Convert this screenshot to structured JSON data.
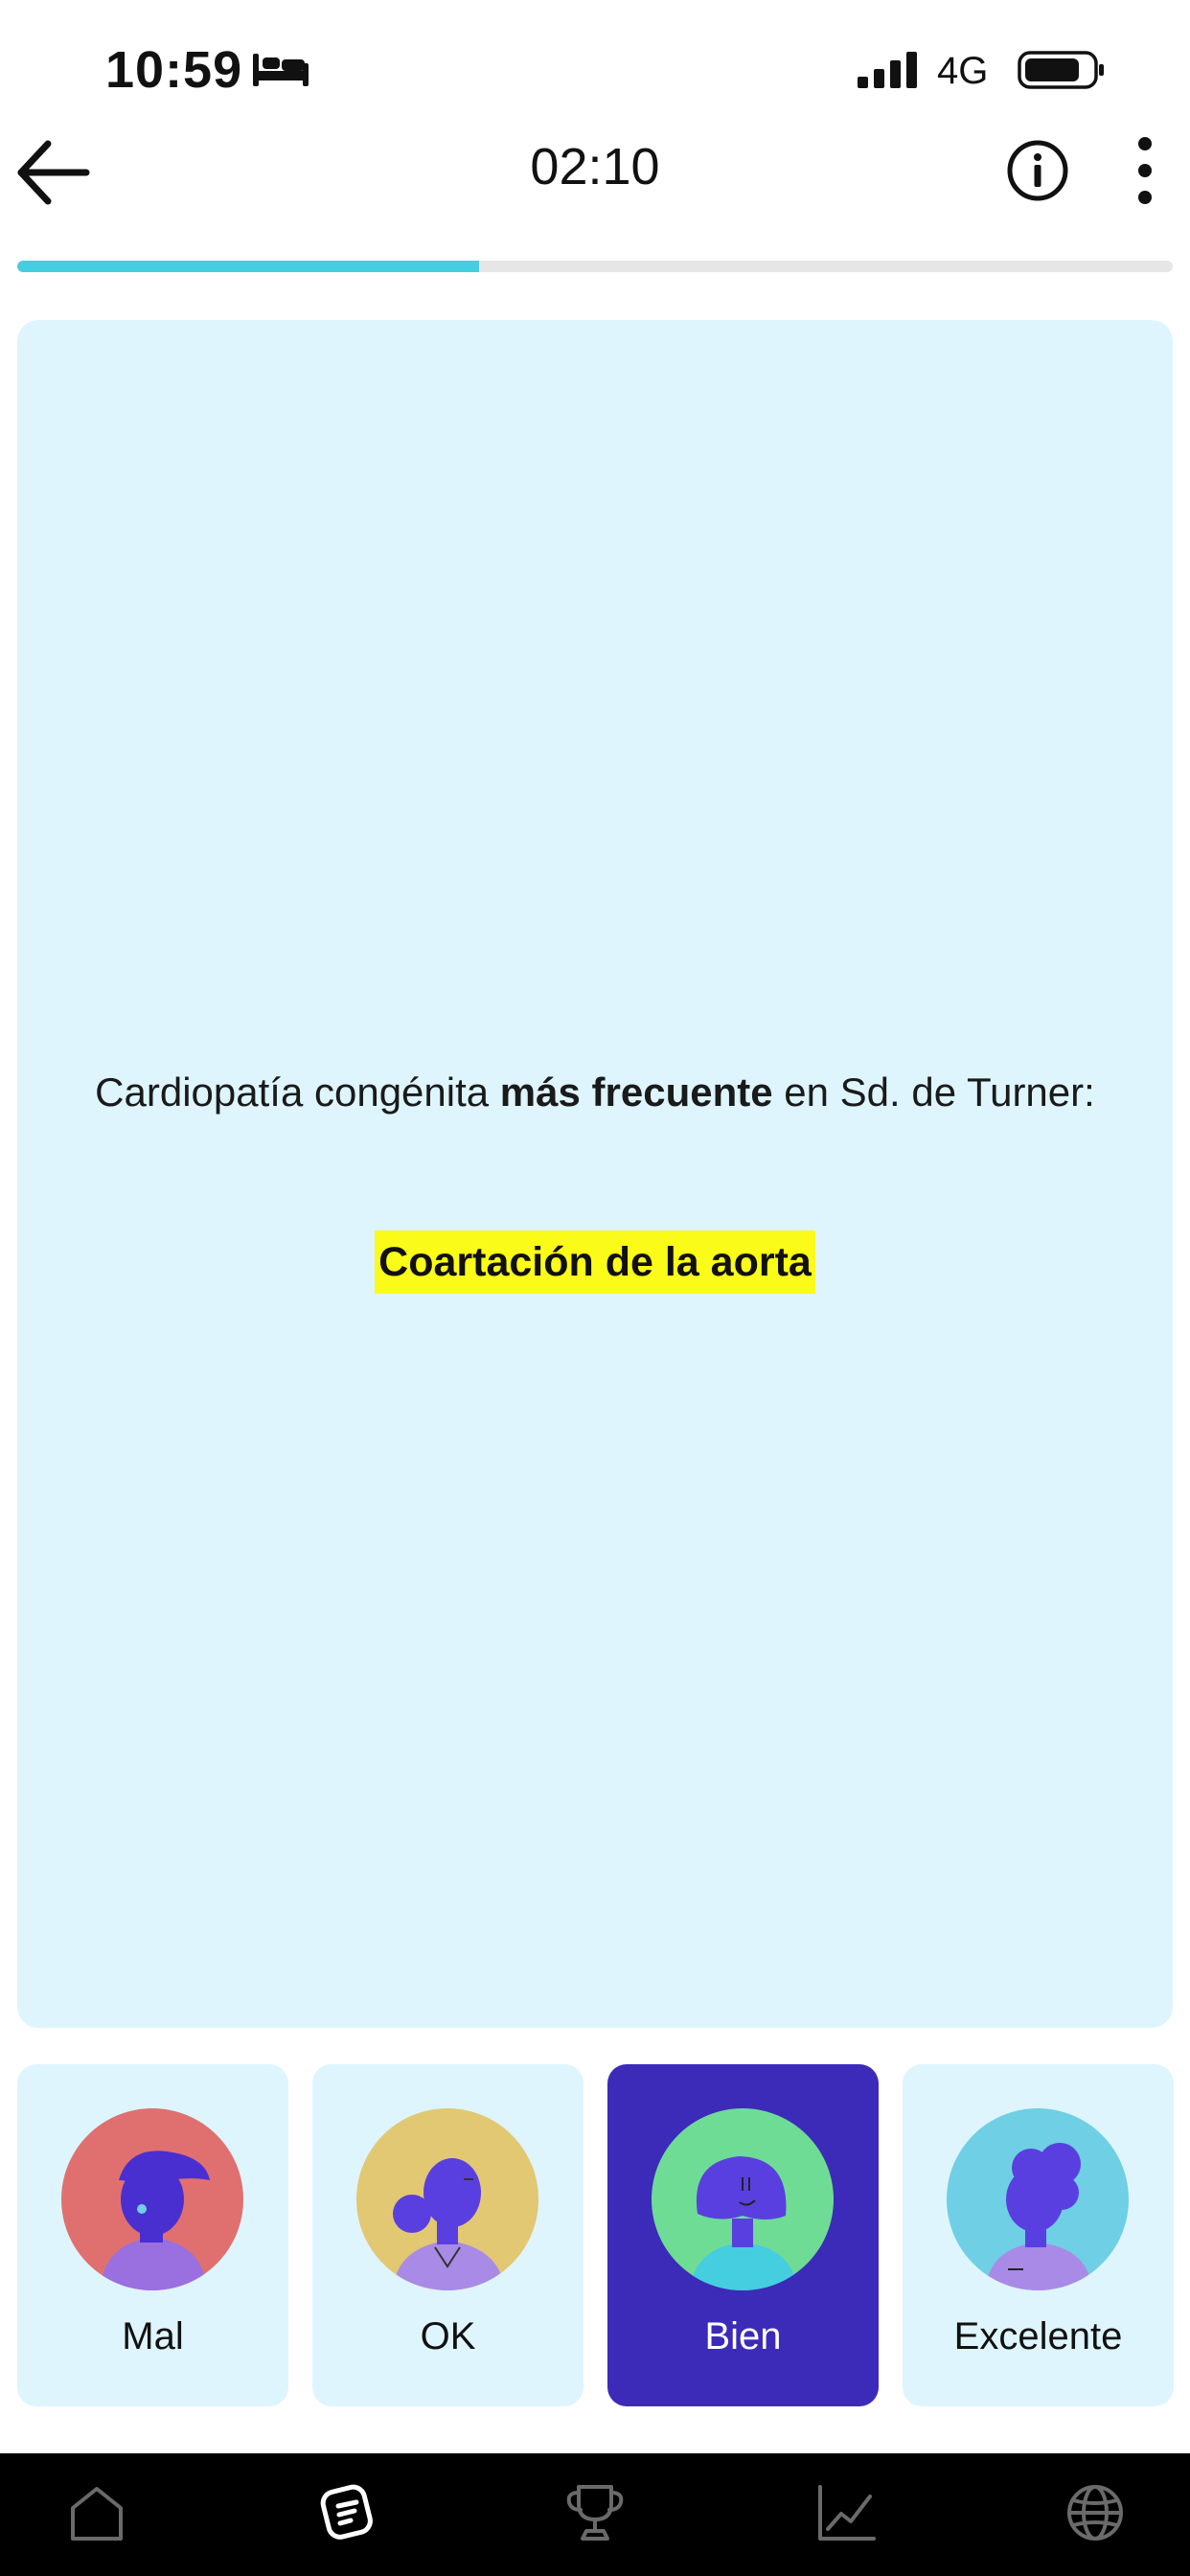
{
  "status_bar": {
    "time": "10:59",
    "network": "4G",
    "icons": [
      "bed-icon",
      "signal-icon",
      "battery-icon"
    ]
  },
  "top_bar": {
    "timer": "02:10",
    "icons": [
      "arrow-left-icon",
      "info-icon",
      "more-vertical-icon"
    ]
  },
  "progress": {
    "fraction": 0.4,
    "color": "#45cde0",
    "track_color": "#e6e6e6"
  },
  "card": {
    "question_part1": "Cardiopatía congénita ",
    "question_bold": "más frecuente",
    "question_part2": " en Sd. de Turner:",
    "answer": "Coartación de la aorta",
    "background": "#def5fd",
    "highlight_color": "#fbfb19"
  },
  "ratings": [
    {
      "label": "Mal",
      "avatar_color": "#e07070",
      "selected": false
    },
    {
      "label": "OK",
      "avatar_color": "#e2c872",
      "selected": false
    },
    {
      "label": "Bien",
      "avatar_color": "#6fdc95",
      "selected": true
    },
    {
      "label": "Excelente",
      "avatar_color": "#6fcfe4",
      "selected": false
    }
  ],
  "bottom_nav": {
    "items": [
      "home-icon",
      "flashcards-icon",
      "trophy-icon",
      "stats-icon",
      "globe-icon"
    ],
    "active": "flashcards-icon"
  },
  "colors": {
    "accent": "#3c2bb9",
    "avatar_figure": "#5a3fe0"
  }
}
